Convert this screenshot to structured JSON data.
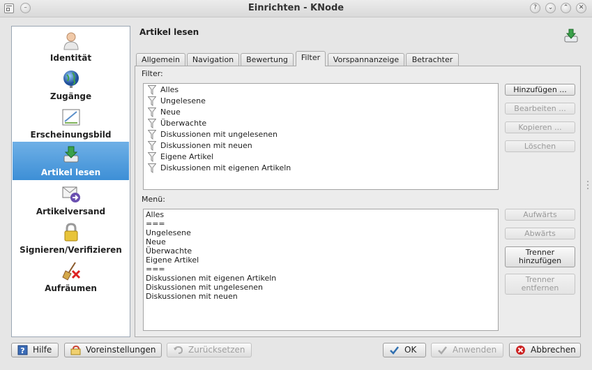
{
  "window": {
    "title": "Einrichten - KNode"
  },
  "sidebar": {
    "items": [
      {
        "label": "Identität",
        "icon": "user-icon"
      },
      {
        "label": "Zugänge",
        "icon": "globe-icon"
      },
      {
        "label": "Erscheinungsbild",
        "icon": "appearance-icon"
      },
      {
        "label": "Artikel lesen",
        "icon": "download-icon",
        "active": true
      },
      {
        "label": "Artikelversand",
        "icon": "send-mail-icon"
      },
      {
        "label": "Signieren/Verifizieren",
        "icon": "lock-icon"
      },
      {
        "label": "Aufräumen",
        "icon": "broom-icon"
      }
    ]
  },
  "page": {
    "title": "Artikel lesen"
  },
  "tabs": [
    {
      "label": "Allgemein"
    },
    {
      "label": "Navigation"
    },
    {
      "label": "Bewertung"
    },
    {
      "label": "Filter",
      "active": true
    },
    {
      "label": "Vorspannanzeige"
    },
    {
      "label": "Betrachter"
    }
  ],
  "filter_section": {
    "label": "Filter:",
    "items": [
      "Alles",
      "Ungelesene",
      "Neue",
      "Überwachte",
      "Diskussionen mit ungelesenen",
      "Diskussionen mit neuen",
      "Eigene Artikel",
      "Diskussionen mit eigenen Artikeln"
    ],
    "buttons": {
      "add": "Hinzufügen ...",
      "edit": "Bearbeiten ...",
      "copy": "Kopieren ...",
      "delete": "Löschen"
    }
  },
  "menu_section": {
    "label": "Menü:",
    "items": [
      "Alles",
      "===",
      "Ungelesene",
      "Neue",
      "Überwachte",
      "Eigene Artikel",
      "===",
      "Diskussionen mit eigenen Artikeln",
      "Diskussionen mit ungelesenen",
      "Diskussionen mit neuen"
    ],
    "buttons": {
      "up": "Aufwärts",
      "down": "Abwärts",
      "add_sep_1": "Trenner",
      "add_sep_2": "hinzufügen",
      "remove_sep_1": "Trenner",
      "remove_sep_2": "entfernen"
    }
  },
  "footer": {
    "help": "Hilfe",
    "defaults": "Voreinstellungen",
    "reset": "Zurücksetzen",
    "ok": "OK",
    "apply": "Anwenden",
    "cancel": "Abbrechen"
  },
  "colors": {
    "accent": "#3d8fd6",
    "ok_check": "#2f6fb0",
    "cancel_red": "#cc2222"
  }
}
